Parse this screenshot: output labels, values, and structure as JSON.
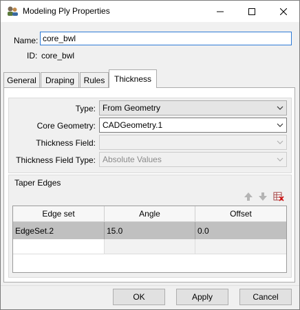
{
  "window": {
    "title": "Modeling Ply Properties"
  },
  "icons": {
    "app": "modeling-ply-app-icon",
    "minimize": "minimize-icon",
    "maximize": "maximize-icon",
    "close": "close-icon"
  },
  "header": {
    "name_label": "Name:",
    "name_value": "core_bwl",
    "id_label": "ID:",
    "id_value": "core_bwl"
  },
  "tabs": [
    {
      "label": "General",
      "active": false
    },
    {
      "label": "Draping",
      "active": false
    },
    {
      "label": "Rules",
      "active": false
    },
    {
      "label": "Thickness",
      "active": true
    }
  ],
  "thickness": {
    "type_label": "Type:",
    "type_value": "From Geometry",
    "core_label": "Core Geometry:",
    "core_value": "CADGeometry.1",
    "field_label": "Thickness Field:",
    "field_value": "",
    "field_type_label": "Thickness Field Type:",
    "field_type_value": "Absolute Values"
  },
  "taper_edges": {
    "title": "Taper Edges",
    "toolbar_icons": [
      "move-up-icon",
      "move-down-icon",
      "delete-table-icon"
    ],
    "columns": [
      "Edge set",
      "Angle",
      "Offset"
    ],
    "rows": [
      {
        "edge_set": "EdgeSet.2",
        "angle": "15.0",
        "offset": "0.0",
        "selected": true
      }
    ]
  },
  "buttons": {
    "ok": "OK",
    "apply": "Apply",
    "cancel": "Cancel"
  }
}
